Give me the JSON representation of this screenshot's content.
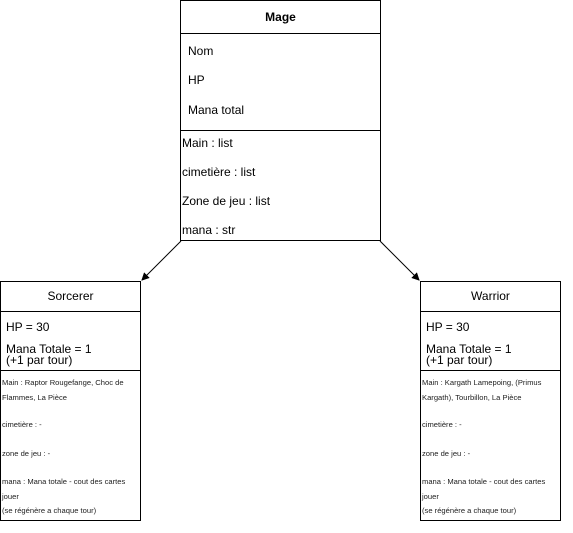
{
  "mage": {
    "title": "Mage",
    "attributes": [
      "Nom",
      "HP",
      "Mana total"
    ],
    "methods": [
      "Main : list",
      "cimetière : list",
      "Zone de jeu : list",
      "mana : str"
    ]
  },
  "sorcerer": {
    "title": "Sorcerer",
    "hp": "HP = 30",
    "mana_totale": "Mana Totale = 1",
    "mana_note": "(+1 par tour)",
    "details": [
      "Main : Raptor Rougefange, Choc de Flammes, La Pièce",
      "cimetière : -",
      "zone de jeu : -",
      "mana : Mana totale - cout des cartes jouer",
      "(se régénère a chaque tour)"
    ]
  },
  "warrior": {
    "title": "Warrior",
    "hp": "HP = 30",
    "mana_totale": "Mana Totale = 1",
    "mana_note": "(+1 par tour)",
    "details": [
      "Main : Kargath Lamepoing, (Primus Kargath), Tourbillon, La Pièce",
      "cimetière : -",
      "zone de jeu : -",
      "mana : Mana totale - cout des cartes jouer",
      "(se régénère a chaque tour)"
    ]
  }
}
